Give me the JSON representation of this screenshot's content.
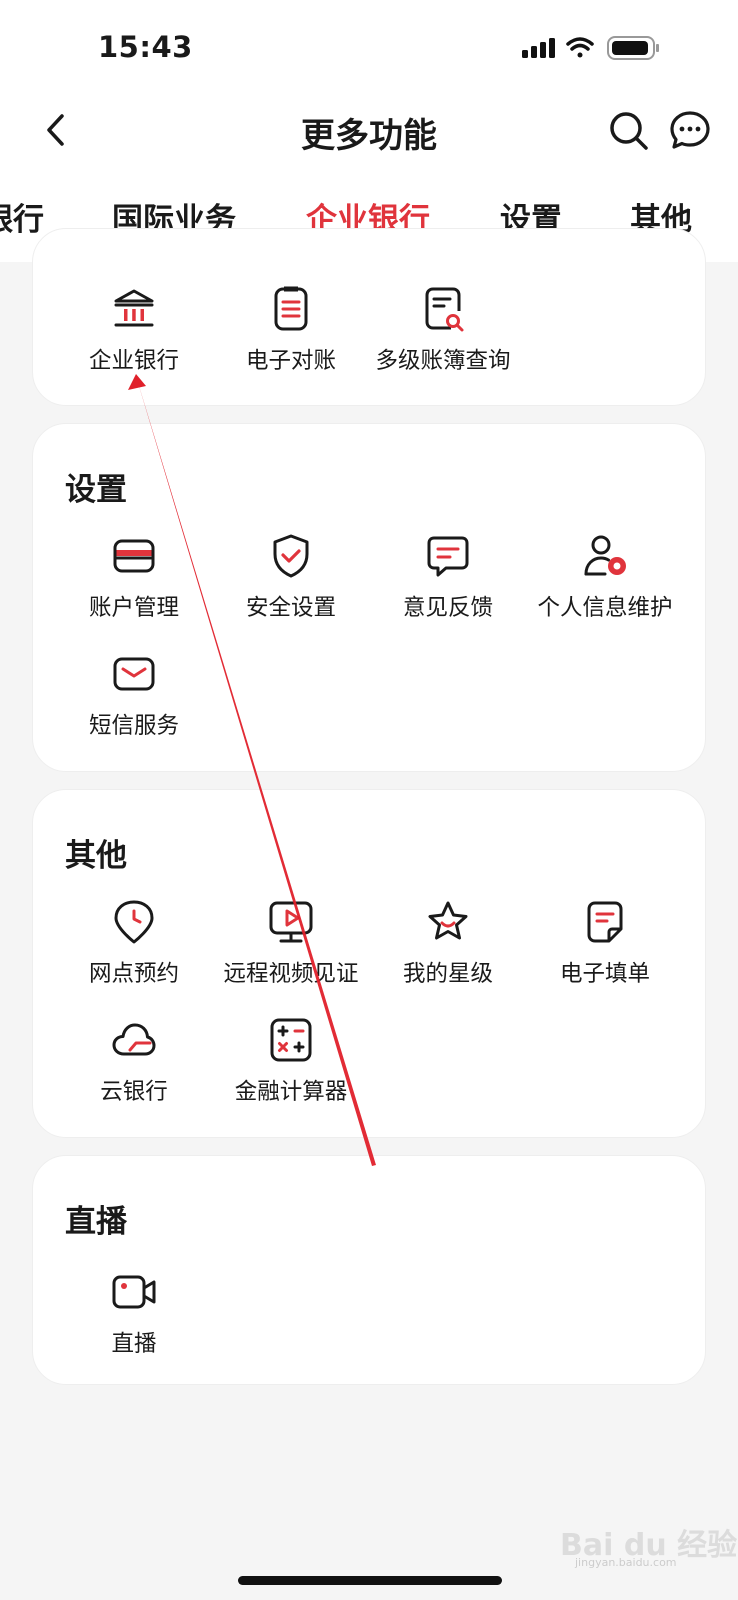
{
  "status_bar": {
    "time": "15:43"
  },
  "nav": {
    "title": "更多功能"
  },
  "tabs": [
    {
      "label": "银行"
    },
    {
      "label": "国际业务"
    },
    {
      "label": "企业银行",
      "active": true
    },
    {
      "label": "设置"
    },
    {
      "label": "其他"
    }
  ],
  "sections": {
    "enterprise": {
      "items": [
        {
          "label": "企业银行",
          "icon": "bank-icon"
        },
        {
          "label": "电子对账",
          "icon": "document-list-icon"
        },
        {
          "label": "多级账簿查询",
          "icon": "document-search-icon"
        }
      ]
    },
    "settings": {
      "title": "设置",
      "items": [
        {
          "label": "账户管理",
          "icon": "card-icon"
        },
        {
          "label": "安全设置",
          "icon": "shield-check-icon"
        },
        {
          "label": "意见反馈",
          "icon": "feedback-icon"
        },
        {
          "label": "个人信息维护",
          "icon": "user-gear-icon"
        },
        {
          "label": "短信服务",
          "icon": "envelope-icon"
        }
      ]
    },
    "other": {
      "title": "其他",
      "items": [
        {
          "label": "网点预约",
          "icon": "location-clock-icon"
        },
        {
          "label": "远程视频见证",
          "icon": "video-monitor-icon"
        },
        {
          "label": "我的星级",
          "icon": "star-icon"
        },
        {
          "label": "电子填单",
          "icon": "form-icon"
        },
        {
          "label": "云银行",
          "icon": "cloud-icon"
        },
        {
          "label": "金融计算器",
          "icon": "calculator-icon"
        }
      ]
    },
    "live": {
      "title": "直播",
      "items": [
        {
          "label": "直播",
          "icon": "video-camera-icon"
        }
      ]
    }
  },
  "watermark": {
    "text": "Bai du 经验",
    "sub": "jingyan.baidu.com"
  },
  "colors": {
    "accent": "#e0343c",
    "text": "#1a1a1a",
    "background": "#f5f5f5",
    "card": "#ffffff"
  }
}
